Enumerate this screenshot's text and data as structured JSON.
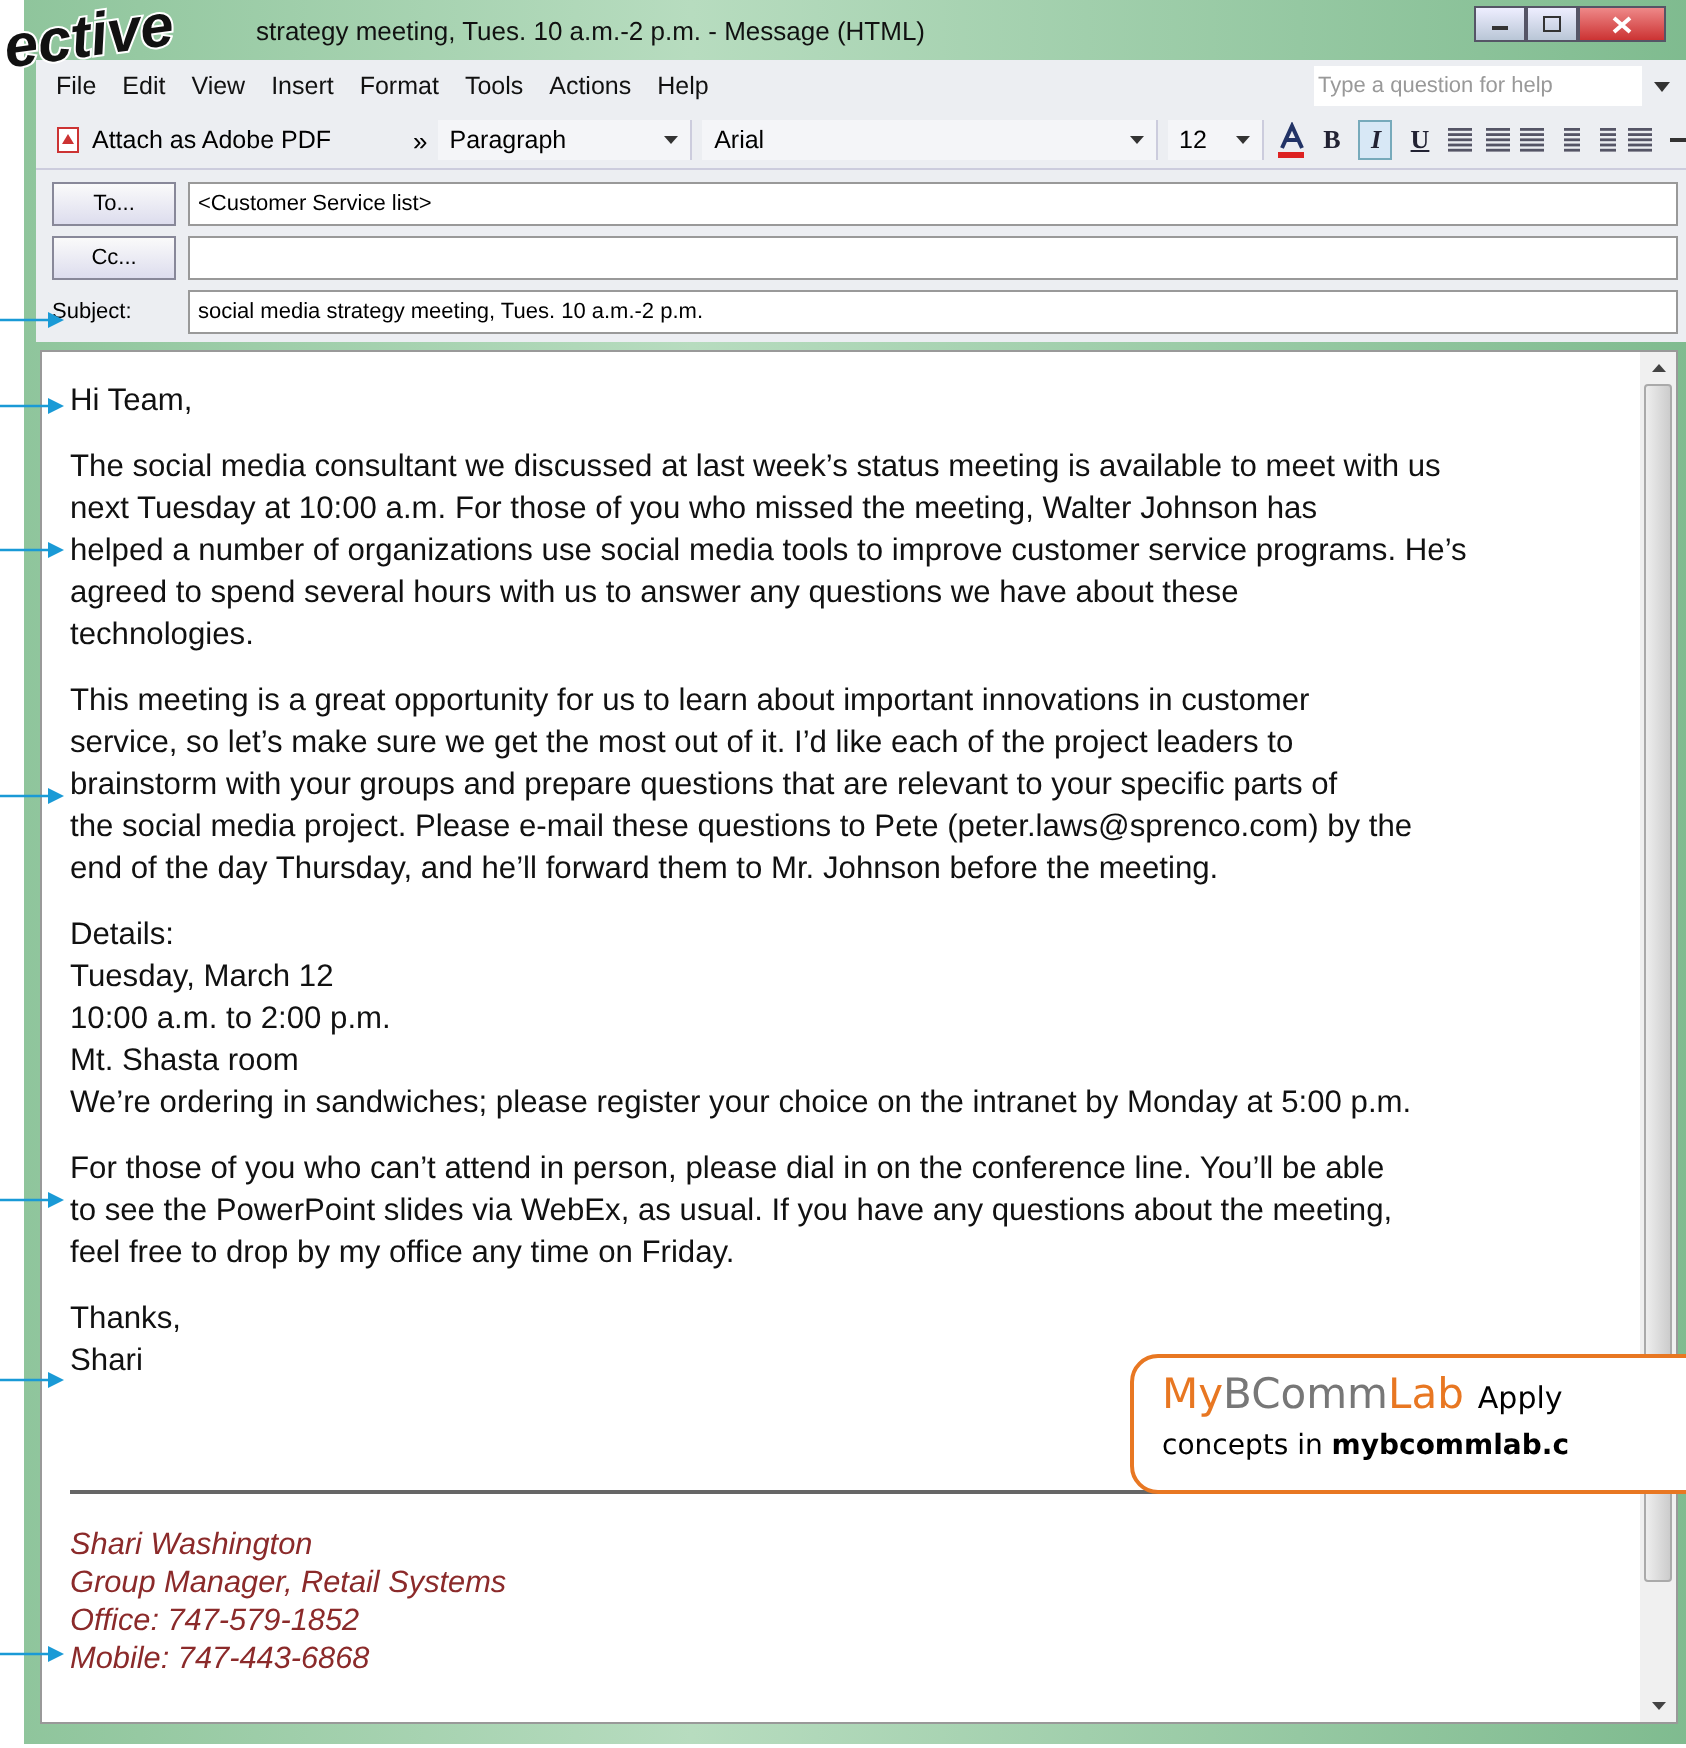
{
  "window": {
    "title": "strategy meeting, Tues. 10 a.m.-2 p.m. - Message (HTML)"
  },
  "overlay_heading": "ective",
  "menu": [
    "File",
    "Edit",
    "View",
    "Insert",
    "Format",
    "Tools",
    "Actions",
    "Help"
  ],
  "help_search": {
    "placeholder": "Type a question for help"
  },
  "toolbar": {
    "attach": "Attach as Adobe PDF",
    "overflow": "»",
    "style": "Paragraph",
    "font": "Arial",
    "size": "12",
    "format_buttons": [
      {
        "label": "B",
        "kind": "bold",
        "selected": false
      },
      {
        "label": "I",
        "kind": "italic",
        "selected": true
      },
      {
        "label": "U",
        "kind": "underline",
        "selected": false
      }
    ]
  },
  "header_fields": [
    {
      "label": "To...",
      "value": "<Customer Service list>",
      "kind": "button"
    },
    {
      "label": "Cc...",
      "kind": "button"
    },
    {
      "label": "Subject:",
      "value": "social media strategy meeting, Tues. 10 a.m.-2 p.m.",
      "kind": "label"
    }
  ],
  "body": [
    {
      "kind": "para",
      "lines": [
        "Hi Team,"
      ]
    },
    {
      "kind": "para",
      "lines": [
        "The social media consultant we discussed at last week’s status meeting is available to meet with us",
        "next Tuesday at 10:00 a.m. For those of you who missed the meeting, Walter Johnson has",
        "helped a number of organizations use social media tools to improve customer service programs. He’s",
        "agreed to spend several hours with us to answer any questions we have about these",
        "technologies."
      ]
    },
    {
      "kind": "para",
      "lines": [
        "This meeting is a great opportunity for us to learn about important innovations in customer",
        "service, so let’s make sure we get the most out of it. I’d like each of the project leaders to",
        "brainstorm with your groups and prepare questions that are relevant to your specific parts of",
        "the social media project. Please e-mail these questions to Pete (peter.laws@sprenco.com) by the",
        "end of the day Thursday, and he’ll forward them to Mr. Johnson before the meeting."
      ]
    },
    {
      "kind": "para",
      "lines": [
        "Details:",
        "Tuesday, March 12",
        "10:00 a.m. to 2:00 p.m.",
        "Mt. Shasta room",
        "We’re ordering in sandwiches; please register your choice on the intranet by Monday at 5:00 p.m."
      ]
    },
    {
      "kind": "para",
      "lines": [
        "For those of you who can’t attend in person, please dial in on the conference line. You’ll be able",
        "to see the PowerPoint slides via WebEx, as usual. If you have any questions about the meeting,",
        "feel free to drop by my office any time on Friday."
      ]
    },
    {
      "kind": "para",
      "lines": [
        "Thanks,",
        "Shari"
      ]
    },
    {
      "kind": "rule"
    },
    {
      "kind": "signature",
      "lines": [
        "Shari Washington",
        "Group Manager, Retail Systems",
        "Office: 747-579-1852",
        "Mobile: 747-443-6868"
      ]
    }
  ],
  "callout": {
    "brand": [
      {
        "text": "My",
        "kind": "accent"
      },
      {
        "text": "BComm",
        "kind": "plain"
      },
      {
        "text": "Lab",
        "kind": "accent"
      }
    ],
    "lead": "Apply",
    "line2": "concepts in **mybcommlab.c**"
  }
}
